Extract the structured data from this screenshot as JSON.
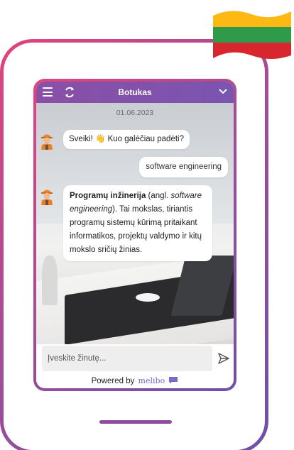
{
  "widget": {
    "title": "Botukas",
    "date": "01.06.2023"
  },
  "messages": [
    {
      "from": "bot",
      "text": "Sveiki! 👋 Kuo galėčiau padėti?"
    },
    {
      "from": "user",
      "text": "software engineering"
    },
    {
      "from": "bot",
      "term": "Programų inžinerija",
      "text_1": " (angl. ",
      "english": "software engineering",
      "text_2": "). Tai mokslas, tiriantis programų sistemų kūrimą pritaikant informatikos, projektų valdymo ir kitų mokslo sričių žinias."
    }
  ],
  "input": {
    "placeholder": "Įveskite žinutę..."
  },
  "footer": {
    "powered_by": "Powered by",
    "brand": "melibo"
  },
  "icons": [
    "menu-icon",
    "refresh-icon",
    "chevron-down-icon",
    "bot-avatar-icon",
    "send-icon",
    "speech-bubble-icon",
    "lithuania-flag"
  ],
  "colors": {
    "header": "#8a4fa6",
    "frame_gradient_start": "#e2447c",
    "frame_gradient_end": "#6b52a8",
    "flag_yellow": "#fdb913",
    "flag_green": "#006a44",
    "flag_red": "#c1272d",
    "brand": "#7a67c9"
  }
}
